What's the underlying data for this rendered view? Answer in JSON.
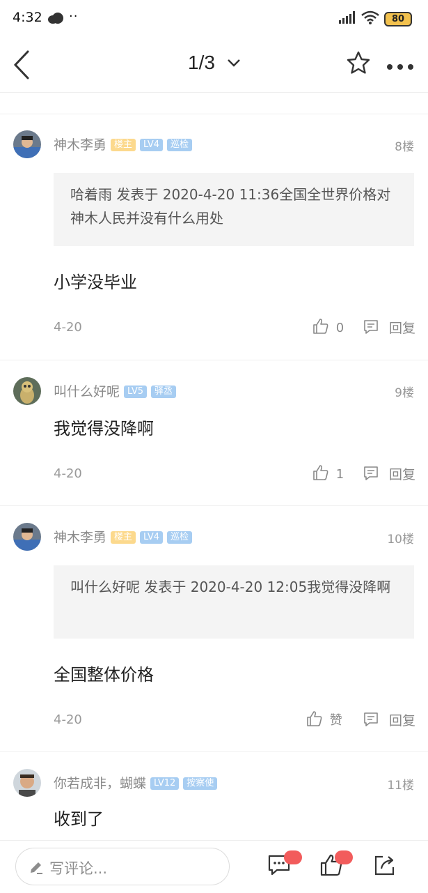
{
  "status_bar": {
    "time": "4:32",
    "dots": "··",
    "battery": "80"
  },
  "nav": {
    "page_indicator": "1/3"
  },
  "posts": [
    {
      "user": "神木李勇",
      "badges": [
        "楼主",
        "LV4",
        "巡检"
      ],
      "floor": "8楼",
      "quote": "哈着雨 发表于 2020-4-20 11:36全国全世界价格对神木人民并没有什么用处",
      "content": "小学没毕业",
      "date": "4-20",
      "likes": "0",
      "reply_label": "回复"
    },
    {
      "user": "叫什么好呢",
      "badges": [
        "LV5",
        "驿丞"
      ],
      "floor": "9楼",
      "content": "我觉得没降啊",
      "date": "4-20",
      "likes": "1",
      "reply_label": "回复"
    },
    {
      "user": "神木李勇",
      "badges": [
        "楼主",
        "LV4",
        "巡检"
      ],
      "floor": "10楼",
      "quote": "叫什么好呢 发表于 2020-4-20 12:05我觉得没降啊",
      "content": "全国整体价格",
      "date": "4-20",
      "likes": "赞",
      "reply_label": "回复"
    },
    {
      "user": "你若成非，蝴蝶",
      "badges": [
        "LV12",
        "按察使"
      ],
      "floor": "11楼",
      "content": "收到了"
    }
  ],
  "bottom_bar": {
    "comment_placeholder": "写评论..."
  },
  "colors": {
    "owner_badge": "#fcd98d",
    "level_badge": "#a7cdf2",
    "notify": "#f25c5c"
  }
}
